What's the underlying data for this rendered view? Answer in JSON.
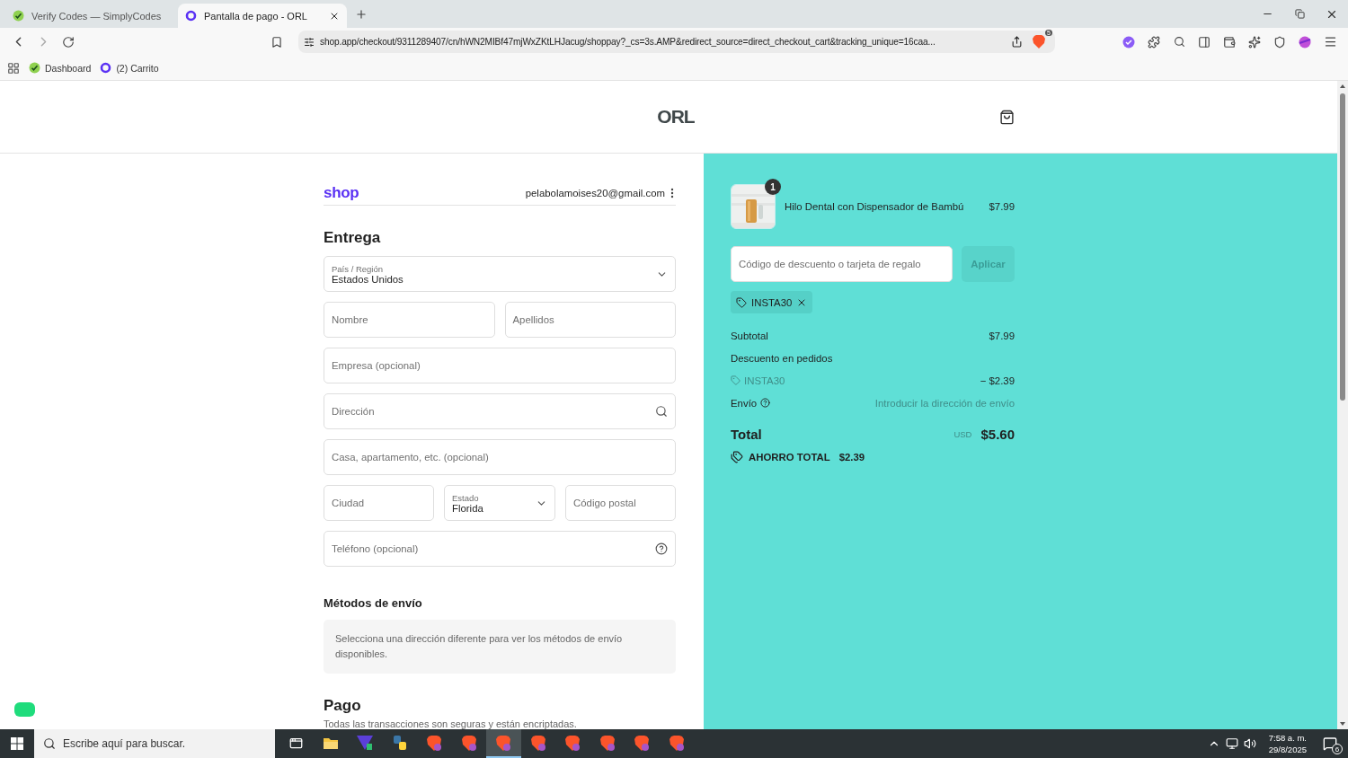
{
  "browser": {
    "tabs": [
      {
        "title": "Verify Codes — SimplyCodes",
        "kind": "check",
        "selected": false
      },
      {
        "title": "Pantalla de pago - ORL",
        "kind": "shop",
        "selected": true
      }
    ],
    "address": "shop.app/checkout/9311289407/cn/hWN2MIBf47mjWxZKtLHJacug/shoppay?_cs=3s.AMP&redirect_source=direct_checkout_cart&tracking_unique=16caa...",
    "shield_count": "5",
    "bookmarks": [
      {
        "title": "Dashboard",
        "kind": "check"
      },
      {
        "title": "(2) Carrito",
        "kind": "shop"
      }
    ]
  },
  "header": {
    "logo": "ORL"
  },
  "checkout": {
    "brand": "shop",
    "email": "pelabolamoises20@gmail.com",
    "delivery": {
      "title": "Entrega",
      "rows": [
        [
          {
            "kind": "select",
            "label": "País / Región",
            "value": "Estados Unidos"
          }
        ],
        [
          {
            "kind": "text",
            "placeholder": "Nombre"
          },
          {
            "kind": "text",
            "placeholder": "Apellidos"
          }
        ],
        [
          {
            "kind": "text",
            "placeholder": "Empresa (opcional)"
          }
        ],
        [
          {
            "kind": "search",
            "placeholder": "Dirección"
          }
        ],
        [
          {
            "kind": "text",
            "placeholder": "Casa, apartamento, etc. (opcional)"
          }
        ],
        [
          {
            "kind": "text",
            "placeholder": "Ciudad"
          },
          {
            "kind": "select",
            "label": "Estado",
            "value": "Florida"
          },
          {
            "kind": "text",
            "placeholder": "Código postal"
          }
        ],
        [
          {
            "kind": "help",
            "placeholder": "Teléfono (opcional)"
          }
        ]
      ]
    },
    "shipping": {
      "title": "Métodos de envío",
      "message": "Selecciona una dirección diferente para ver los métodos de envío disponibles."
    },
    "payment": {
      "title": "Pago",
      "subtitle": "Todas las transacciones son seguras y están encriptadas."
    }
  },
  "summary": {
    "item": {
      "name": "Hilo Dental con Dispensador de Bambú",
      "price": "$7.99",
      "quantity": "1"
    },
    "discount_placeholder": "Código de descuento o tarjeta de regalo",
    "apply": {
      "label": "Aplicar",
      "disabled": true
    },
    "applied_code": "INSTA30",
    "subtotal_label": "Subtotal",
    "subtotal": "$7.99",
    "discount_label": "Descuento en pedidos",
    "discount_code": "INSTA30",
    "discount_amount": "− $2.39",
    "shipping_label": "Envío",
    "shipping_value": "Introducir la dirección de envío",
    "total_label": "Total",
    "currency": "USD",
    "total": "$5.60",
    "savings_label": "AHORRO TOTAL",
    "savings": "$2.39"
  },
  "taskbar": {
    "search_placeholder": "Escribe aquí para buscar.",
    "apps": [
      {
        "kind": "taskview",
        "selected": false
      },
      {
        "kind": "folder",
        "selected": false
      },
      {
        "kind": "vpn",
        "selected": false
      },
      {
        "kind": "python",
        "selected": false
      },
      {
        "kind": "brave",
        "selected": false
      },
      {
        "kind": "brave",
        "selected": false
      },
      {
        "kind": "brave",
        "selected": true
      },
      {
        "kind": "brave",
        "selected": false
      },
      {
        "kind": "brave",
        "selected": false
      },
      {
        "kind": "brave",
        "selected": false
      },
      {
        "kind": "brave",
        "selected": false
      },
      {
        "kind": "brave",
        "selected": false
      }
    ],
    "time": "7:58 a. m.",
    "date": "29/8/2025",
    "notifications": "6"
  }
}
